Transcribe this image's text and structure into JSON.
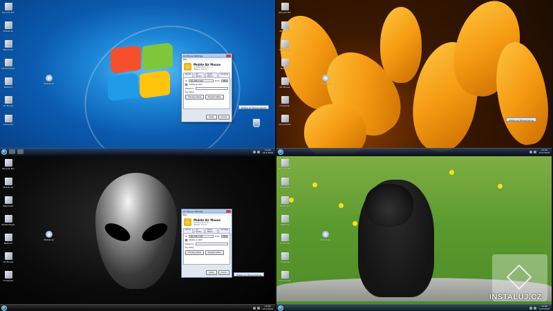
{
  "window": {
    "title": "Air Mouse Settings",
    "menu": "File",
    "app_name": "Mobile Air Mouse",
    "company": "(c) R.P.A. Tech, Inc.",
    "version": "Version: 2.0.1.1",
    "website": "Website",
    "tabs": [
      "Server",
      "Air Motion",
      "Touch Motion",
      "Scrolling"
    ],
    "server_label": "Server",
    "ip_label": "IP:",
    "ip_value": "192.168.1.100",
    "port_label": "Ports:",
    "port_value": "8888",
    "startup_label": "Update on start",
    "password_label": "Password:",
    "key_setup_label": "Key Setup",
    "btn_hot_keys": "Hot Keys Setup",
    "btn_program": "Program Setup",
    "btn_ok": "Apply",
    "btn_cancel": "Cancel"
  },
  "desktop_icons": [
    "Recycle Bin",
    "Mobile Air",
    "Bandicam",
    "Media Player",
    "Network",
    "Air Mouse",
    "Computer",
    "Documents"
  ],
  "floating_icon": "Mobile Air",
  "toast": "Mobile Air Mouse Server",
  "clock": {
    "time": "13:40",
    "date": "14.5.2010"
  },
  "watermark": "INSTALUJ.CZ",
  "colors": {
    "win7_blue": "#1d86d6",
    "taskbar": "#1a2a44",
    "window_bg": "#dfe7f1"
  }
}
